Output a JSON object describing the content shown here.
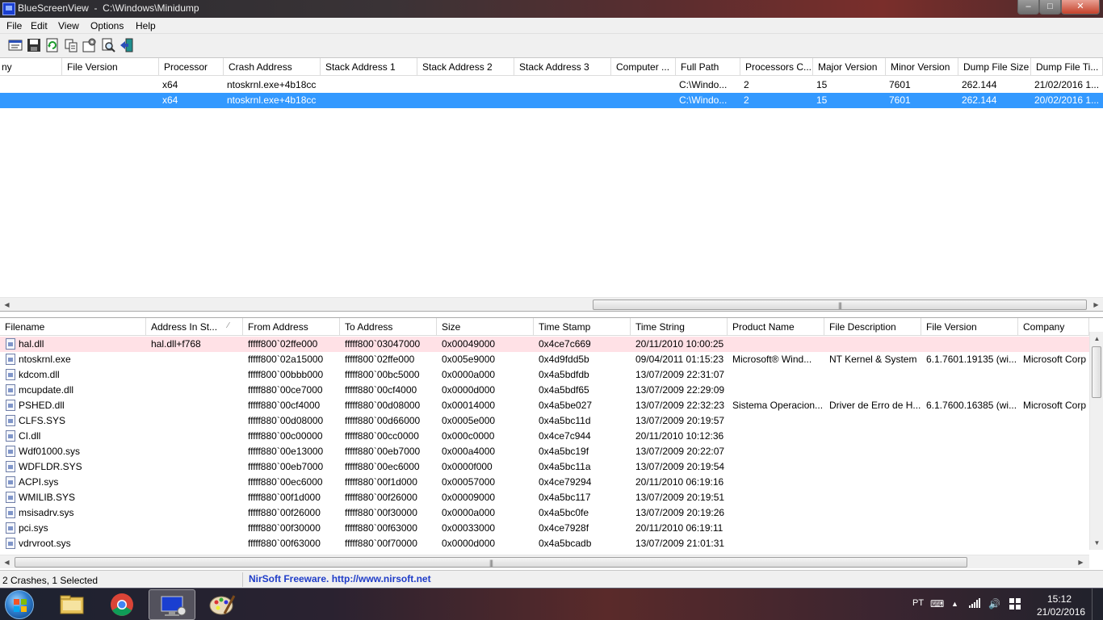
{
  "window": {
    "title": "BlueScreenView  -  C:\\Windows\\Minidump",
    "min_label": "–",
    "max_label": "□",
    "close_label": "✕"
  },
  "menu": [
    {
      "label": "File"
    },
    {
      "label": "Edit"
    },
    {
      "label": "View"
    },
    {
      "label": "Options"
    },
    {
      "label": "Help"
    }
  ],
  "toolbar": [
    {
      "icon": "properties-icon"
    },
    {
      "icon": "save-icon"
    },
    {
      "icon": "refresh-icon"
    },
    {
      "icon": "copy-icon"
    },
    {
      "icon": "advanced-options-icon"
    },
    {
      "icon": "find-icon"
    },
    {
      "icon": "exit-icon"
    }
  ],
  "crash_list": {
    "columns": [
      "ny",
      "File Version",
      "Processor",
      "Crash Address",
      "Stack Address 1",
      "Stack Address 2",
      "Stack Address 3",
      "Computer ...",
      "Full Path",
      "Processors C...",
      "Major Version",
      "Minor Version",
      "Dump File Size",
      "Dump File Ti..."
    ],
    "rows": [
      {
        "selected": false,
        "cells": [
          "",
          "",
          "x64",
          "ntoskrnl.exe+4b18cc",
          "",
          "",
          "",
          "",
          "C:\\Windo...",
          "2",
          "15",
          "7601",
          "262.144",
          "21/02/2016 1..."
        ]
      },
      {
        "selected": true,
        "cells": [
          "",
          "",
          "x64",
          "ntoskrnl.exe+4b18cc",
          "",
          "",
          "",
          "",
          "C:\\Windo...",
          "2",
          "15",
          "7601",
          "262.144",
          "20/02/2016 1..."
        ]
      }
    ],
    "scroll_grip": "|||"
  },
  "driver_list": {
    "columns": [
      "Filename",
      "Address In St...",
      "From Address",
      "To Address",
      "Size",
      "Time Stamp",
      "Time String",
      "Product Name",
      "File Description",
      "File Version",
      "Company"
    ],
    "sort_indicator": "∕",
    "rows": [
      {
        "highlight": true,
        "cells": [
          "hal.dll",
          "hal.dll+f768",
          "fffff800`02ffe000",
          "fffff800`03047000",
          "0x00049000",
          "0x4ce7c669",
          "20/11/2010 10:00:25",
          "",
          "",
          "",
          ""
        ]
      },
      {
        "highlight": false,
        "cells": [
          "ntoskrnl.exe",
          "",
          "fffff800`02a15000",
          "fffff800`02ffe000",
          "0x005e9000",
          "0x4d9fdd5b",
          "09/04/2011 01:15:23",
          "Microsoft® Wind...",
          "NT Kernel & System",
          "6.1.7601.19135 (wi...",
          "Microsoft Corp"
        ]
      },
      {
        "highlight": false,
        "cells": [
          "kdcom.dll",
          "",
          "fffff800`00bbb000",
          "fffff800`00bc5000",
          "0x0000a000",
          "0x4a5bdfdb",
          "13/07/2009 22:31:07",
          "",
          "",
          "",
          ""
        ]
      },
      {
        "highlight": false,
        "cells": [
          "mcupdate.dll",
          "",
          "fffff880`00ce7000",
          "fffff880`00cf4000",
          "0x0000d000",
          "0x4a5bdf65",
          "13/07/2009 22:29:09",
          "",
          "",
          "",
          ""
        ]
      },
      {
        "highlight": false,
        "cells": [
          "PSHED.dll",
          "",
          "fffff880`00cf4000",
          "fffff880`00d08000",
          "0x00014000",
          "0x4a5be027",
          "13/07/2009 22:32:23",
          "Sistema Operacion...",
          "Driver de Erro de H...",
          "6.1.7600.16385 (wi...",
          "Microsoft Corp"
        ]
      },
      {
        "highlight": false,
        "cells": [
          "CLFS.SYS",
          "",
          "fffff880`00d08000",
          "fffff880`00d66000",
          "0x0005e000",
          "0x4a5bc11d",
          "13/07/2009 20:19:57",
          "",
          "",
          "",
          ""
        ]
      },
      {
        "highlight": false,
        "cells": [
          "CI.dll",
          "",
          "fffff880`00c00000",
          "fffff880`00cc0000",
          "0x000c0000",
          "0x4ce7c944",
          "20/11/2010 10:12:36",
          "",
          "",
          "",
          ""
        ]
      },
      {
        "highlight": false,
        "cells": [
          "Wdf01000.sys",
          "",
          "fffff880`00e13000",
          "fffff880`00eb7000",
          "0x000a4000",
          "0x4a5bc19f",
          "13/07/2009 20:22:07",
          "",
          "",
          "",
          ""
        ]
      },
      {
        "highlight": false,
        "cells": [
          "WDFLDR.SYS",
          "",
          "fffff880`00eb7000",
          "fffff880`00ec6000",
          "0x0000f000",
          "0x4a5bc11a",
          "13/07/2009 20:19:54",
          "",
          "",
          "",
          ""
        ]
      },
      {
        "highlight": false,
        "cells": [
          "ACPI.sys",
          "",
          "fffff880`00ec6000",
          "fffff880`00f1d000",
          "0x00057000",
          "0x4ce79294",
          "20/11/2010 06:19:16",
          "",
          "",
          "",
          ""
        ]
      },
      {
        "highlight": false,
        "cells": [
          "WMILIB.SYS",
          "",
          "fffff880`00f1d000",
          "fffff880`00f26000",
          "0x00009000",
          "0x4a5bc117",
          "13/07/2009 20:19:51",
          "",
          "",
          "",
          ""
        ]
      },
      {
        "highlight": false,
        "cells": [
          "msisadrv.sys",
          "",
          "fffff880`00f26000",
          "fffff880`00f30000",
          "0x0000a000",
          "0x4a5bc0fe",
          "13/07/2009 20:19:26",
          "",
          "",
          "",
          ""
        ]
      },
      {
        "highlight": false,
        "cells": [
          "pci.sys",
          "",
          "fffff880`00f30000",
          "fffff880`00f63000",
          "0x00033000",
          "0x4ce7928f",
          "20/11/2010 06:19:11",
          "",
          "",
          "",
          ""
        ]
      },
      {
        "highlight": false,
        "cells": [
          "vdrvroot.sys",
          "",
          "fffff880`00f63000",
          "fffff880`00f70000",
          "0x0000d000",
          "0x4a5bcadb",
          "13/07/2009 21:01:31",
          "",
          "",
          "",
          ""
        ]
      }
    ],
    "scroll_grip": "|||"
  },
  "statusbar": {
    "count": "2 Crashes, 1 Selected",
    "link": "NirSoft Freeware.  http://www.nirsoft.net"
  },
  "taskbar": {
    "apps": [
      {
        "icon": "file-explorer-icon",
        "active": false
      },
      {
        "icon": "chrome-icon",
        "active": false
      },
      {
        "icon": "bluescreenview-icon",
        "active": true
      },
      {
        "icon": "paint-icon",
        "active": false
      }
    ],
    "language": "PT",
    "time": "15:12",
    "date": "21/02/2016"
  },
  "colors": {
    "selection": "#3399ff",
    "highlight_row": "#ffe1e6",
    "link": "#1e3cc8"
  }
}
